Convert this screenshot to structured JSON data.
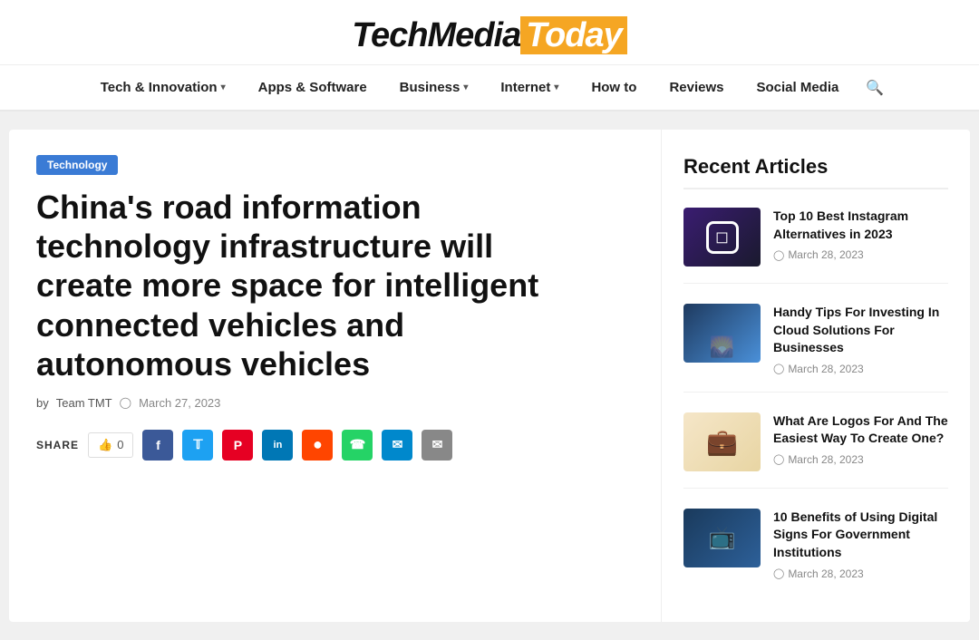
{
  "header": {
    "logo": {
      "tech": "Tech",
      "media": "Media",
      "today": "Today"
    }
  },
  "nav": {
    "items": [
      {
        "label": "Tech & Innovation",
        "hasDropdown": true
      },
      {
        "label": "Apps & Software",
        "hasDropdown": false
      },
      {
        "label": "Business",
        "hasDropdown": true
      },
      {
        "label": "Internet",
        "hasDropdown": true
      },
      {
        "label": "How to",
        "hasDropdown": false
      },
      {
        "label": "Reviews",
        "hasDropdown": false
      },
      {
        "label": "Social Media",
        "hasDropdown": false
      }
    ]
  },
  "article": {
    "category": "Technology",
    "title": "China's road information technology infrastructure will create more space for intelligent connected vehicles and autonomous vehicles",
    "meta": {
      "by": "by",
      "author": "Team TMT",
      "date": "March 27, 2023"
    },
    "share": {
      "label": "SHARE",
      "like_count": "0"
    }
  },
  "sidebar": {
    "title": "Recent Articles",
    "articles": [
      {
        "id": 1,
        "title": "Top 10 Best Instagram Alternatives in 2023",
        "date": "March 28, 2023",
        "thumb_type": "instagram"
      },
      {
        "id": 2,
        "title": "Handy Tips For Investing In Cloud Solutions For Businesses",
        "date": "March 28, 2023",
        "thumb_type": "cloud"
      },
      {
        "id": 3,
        "title": "What Are Logos For And The Easiest Way To Create One?",
        "date": "March 28, 2023",
        "thumb_type": "logos"
      },
      {
        "id": 4,
        "title": "10 Benefits of Using Digital Signs For Government Institutions",
        "date": "March 28, 2023",
        "thumb_type": "digital"
      }
    ]
  },
  "social_buttons": [
    {
      "label": "f",
      "class": "fb",
      "title": "Facebook"
    },
    {
      "label": "t",
      "class": "tw",
      "title": "Twitter"
    },
    {
      "label": "P",
      "class": "pi",
      "title": "Pinterest"
    },
    {
      "label": "in",
      "class": "li",
      "title": "LinkedIn"
    },
    {
      "label": "●",
      "class": "rd",
      "title": "Reddit"
    },
    {
      "label": "✆",
      "class": "wa",
      "title": "WhatsApp"
    },
    {
      "label": "✈",
      "class": "tg",
      "title": "Telegram"
    },
    {
      "label": "✉",
      "class": "em",
      "title": "Email"
    }
  ]
}
